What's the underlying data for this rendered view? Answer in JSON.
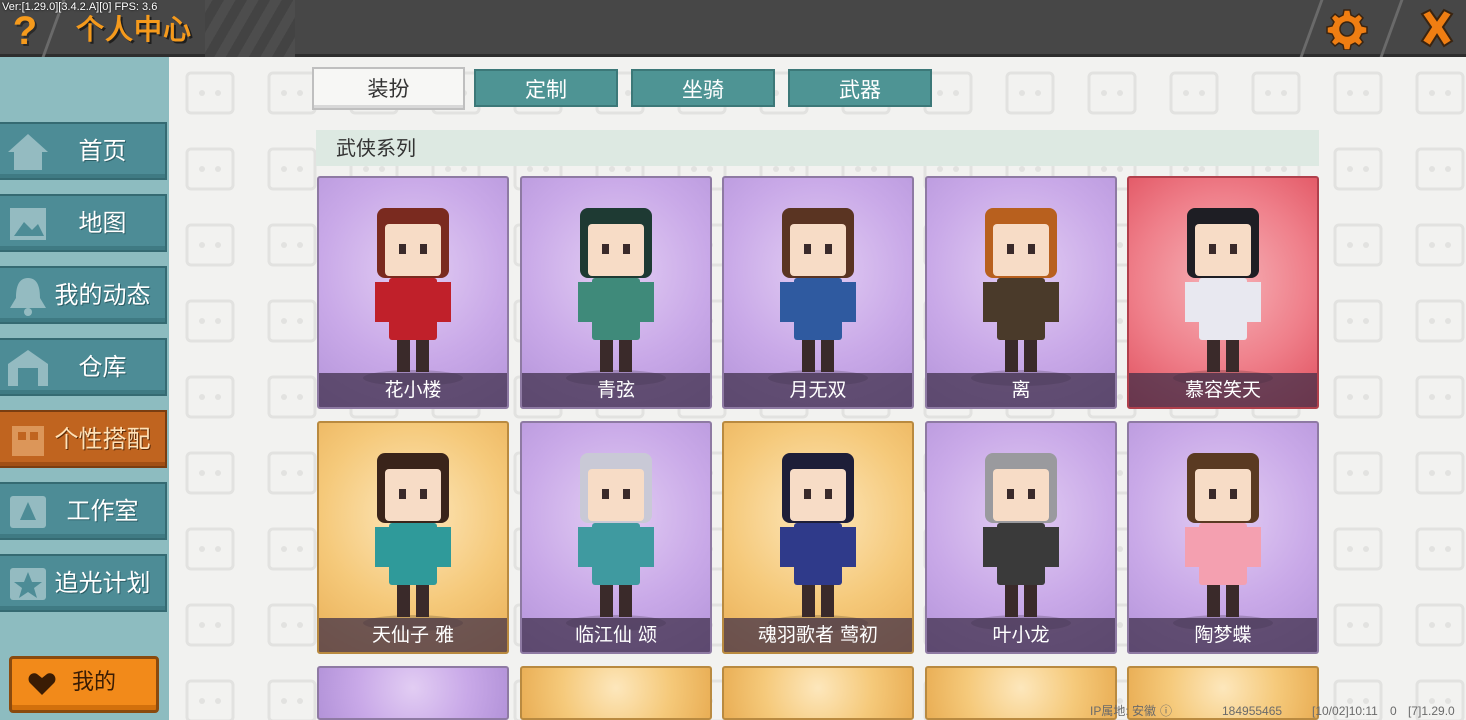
{
  "topbar": {
    "version_text": "Ver:[1.29.0][3.4.2.A][0] FPS: 3.6",
    "help_glyph": "?",
    "title": "个人中心",
    "settings_icon": "gear-icon",
    "close_icon": "close-icon",
    "accent_color": "#f59a1c"
  },
  "sidebar": {
    "items": [
      {
        "label": "首页",
        "icon": "house-icon"
      },
      {
        "label": "地图",
        "icon": "map-icon"
      },
      {
        "label": "我的动态",
        "icon": "bell-icon"
      },
      {
        "label": "仓库",
        "icon": "warehouse-icon"
      },
      {
        "label": "个性搭配",
        "icon": "outfit-icon",
        "active": true
      },
      {
        "label": "工作室",
        "icon": "studio-icon"
      },
      {
        "label": "追光计划",
        "icon": "star-plan-icon"
      }
    ],
    "mine_label": "我的",
    "mine_icon": "heart-icon"
  },
  "tabs": [
    {
      "label": "装扮",
      "active": true
    },
    {
      "label": "定制"
    },
    {
      "label": "坐骑"
    },
    {
      "label": "武器"
    }
  ],
  "section_title": "武侠系列",
  "cards": [
    {
      "name": "花小楼",
      "theme": "purple"
    },
    {
      "name": "青弦",
      "theme": "purple"
    },
    {
      "name": "月无双",
      "theme": "purple"
    },
    {
      "name": "离",
      "theme": "purple"
    },
    {
      "name": "慕容笑天",
      "theme": "red"
    },
    {
      "name": "天仙子 雅",
      "theme": "gold"
    },
    {
      "name": "临江仙 颂",
      "theme": "purple"
    },
    {
      "name": "魂羽歌者 莺初",
      "theme": "gold"
    },
    {
      "name": "叶小龙",
      "theme": "purple"
    },
    {
      "name": "陶梦蝶",
      "theme": "purple"
    }
  ],
  "partial_row_themes": [
    "purple",
    "gold",
    "gold",
    "gold",
    "gold"
  ],
  "footer": {
    "ip_location": "IP属地: 安徽",
    "uid": "184955465",
    "datetime": "[10/02]10:11",
    "channel": "0",
    "build": "[7]1.29.0"
  }
}
